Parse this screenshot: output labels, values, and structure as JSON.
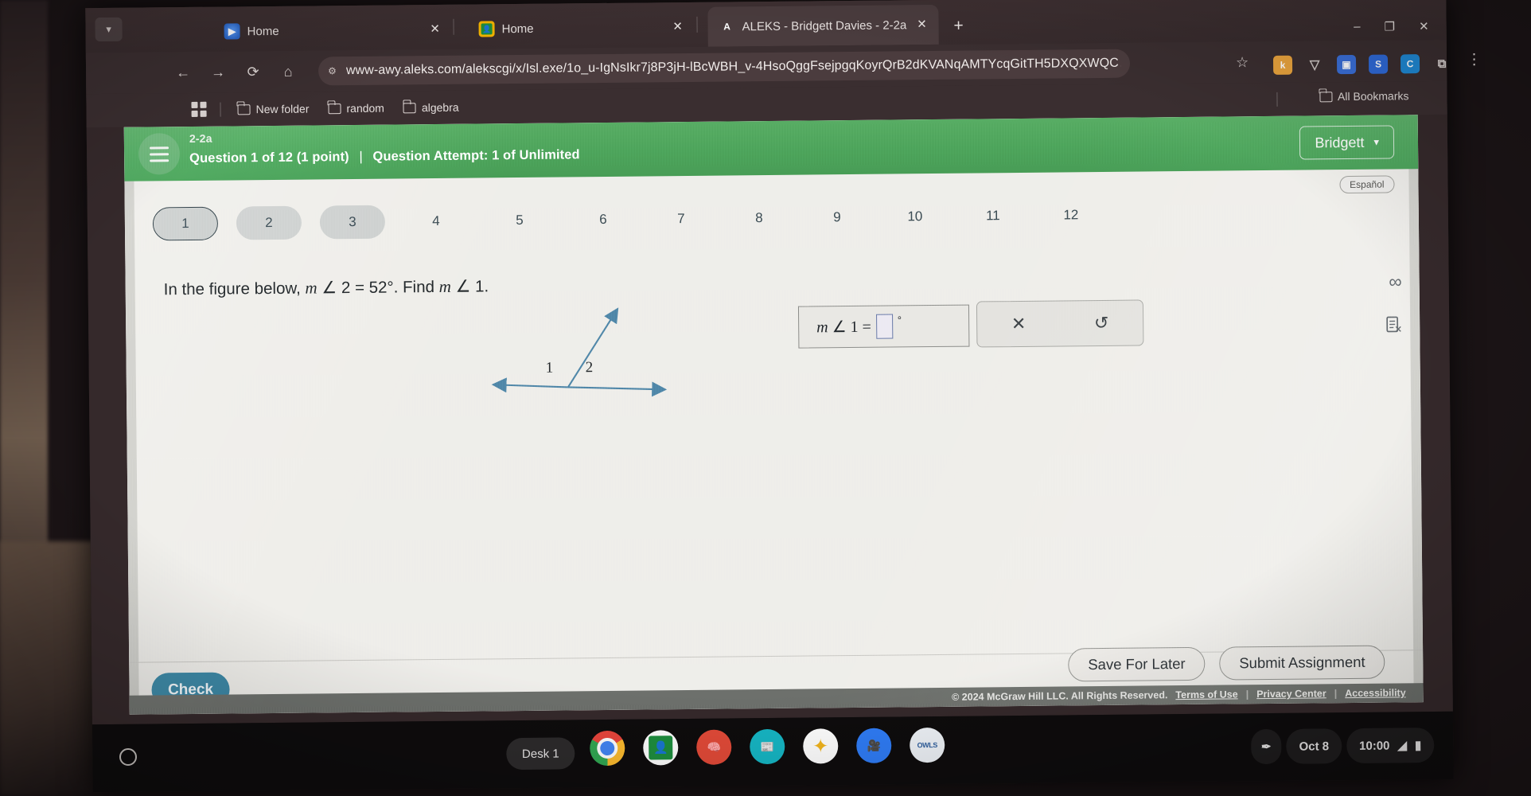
{
  "browser": {
    "tabs": [
      {
        "title": "Home",
        "icon": "google-meet-icon",
        "active": false
      },
      {
        "title": "Home",
        "icon": "google-classroom-icon",
        "active": false
      },
      {
        "title": "ALEKS - Bridgett Davies - 2-2a",
        "icon": "aleks-icon",
        "active": true
      }
    ],
    "new_tab_label": "+",
    "window_controls": {
      "minimize": "–",
      "maximize": "❐",
      "close": "✕"
    },
    "nav": {
      "back": "←",
      "forward": "→",
      "reload": "⟳",
      "home": "⌂"
    },
    "omnibox": {
      "site_icon": "permissions-icon",
      "url": "www-awy.aleks.com/alekscgi/x/Isl.exe/1o_u-IgNsIkr7j8P3jH-lBcWBH_v-4HsoQggFsejpgqKoyrQrB2dKVANqAMTYcqGitTH5DXQXWQC…",
      "star_icon": "bookmark-star-icon"
    },
    "extensions": [
      {
        "name": "kami-extension",
        "label": "k",
        "color": "#e8a33d"
      },
      {
        "name": "shield-extension",
        "label": "▽",
        "color": "#5a6a78"
      },
      {
        "name": "blue-extension",
        "label": "▣",
        "color": "#3a6fd8"
      },
      {
        "name": "s-extension",
        "label": "S",
        "color": "#2f6ad9"
      },
      {
        "name": "c-extension",
        "label": "C",
        "color": "#1f8ad6"
      },
      {
        "name": "puzzle-extension",
        "label": "⧉",
        "color": "#4a3c3e"
      }
    ],
    "kebab_icon": "⋮",
    "bookmarks": [
      "New folder",
      "random",
      "algebra"
    ],
    "all_bookmarks_label": "All Bookmarks"
  },
  "aleks": {
    "header": {
      "assignment": "2-2a",
      "question_progress": "Question 1 of 12 (1 point)",
      "pipe": "|",
      "attempt": "Question Attempt: 1 of Unlimited",
      "user": "Bridgett",
      "user_caret": "▾",
      "bg_color": "#4ca35a"
    },
    "language_toggle": "Español",
    "pills": [
      {
        "n": "1",
        "state": "current"
      },
      {
        "n": "2",
        "state": "filled"
      },
      {
        "n": "3",
        "state": "filled"
      },
      {
        "n": "4",
        "state": "plain"
      },
      {
        "n": "5",
        "state": "plain"
      },
      {
        "n": "6",
        "state": "plain"
      },
      {
        "n": "7",
        "state": "plain"
      },
      {
        "n": "8",
        "state": "plain"
      },
      {
        "n": "9",
        "state": "plain"
      },
      {
        "n": "10",
        "state": "plain"
      },
      {
        "n": "11",
        "state": "plain"
      },
      {
        "n": "12",
        "state": "plain"
      }
    ],
    "question": {
      "lead": "In the figure below,",
      "m1": "m",
      "angle_glyph": "∠",
      "given_angle": "2",
      "equals": "=",
      "given_value": "52°.",
      "find": "Find",
      "m2": "m",
      "target_angle": "1."
    },
    "figure": {
      "label_left": "1",
      "label_right": "2",
      "stroke_color": "#4f86a8"
    },
    "answer": {
      "label_m": "m",
      "label_angle": "∠",
      "label_num": "1",
      "label_eq": "=",
      "value": "",
      "degree": "°"
    },
    "toolbox": {
      "clear_icon": "✕",
      "undo_icon": "↺"
    },
    "rail": {
      "infinity_icon": "∞",
      "note_icon": "Ὓ9"
    },
    "buttons": {
      "check": "Check",
      "save_for_later": "Save For Later",
      "submit_assignment": "Submit Assignment"
    },
    "footer": {
      "copyright": "© 2024 McGraw Hill LLC. All Rights Reserved.",
      "terms": "Terms of Use",
      "privacy": "Privacy Center",
      "accessibility": "Accessibility",
      "sep": "|"
    }
  },
  "shelf": {
    "desk_label": "Desk 1",
    "apps": [
      {
        "name": "chrome-app",
        "label": ""
      },
      {
        "name": "google-classroom-app",
        "label": "▤"
      },
      {
        "name": "brain-app",
        "label": "⌾"
      },
      {
        "name": "news-app",
        "label": "▤"
      },
      {
        "name": "star-app",
        "label": "✦"
      },
      {
        "name": "zoom-app",
        "label": "▣"
      },
      {
        "name": "book-app",
        "label": "OWLS"
      }
    ],
    "tray": {
      "pen_icon": "✒",
      "date": "Oct 8",
      "time": "10:00",
      "wifi_icon": "▲",
      "battery_icon": "▯"
    }
  }
}
